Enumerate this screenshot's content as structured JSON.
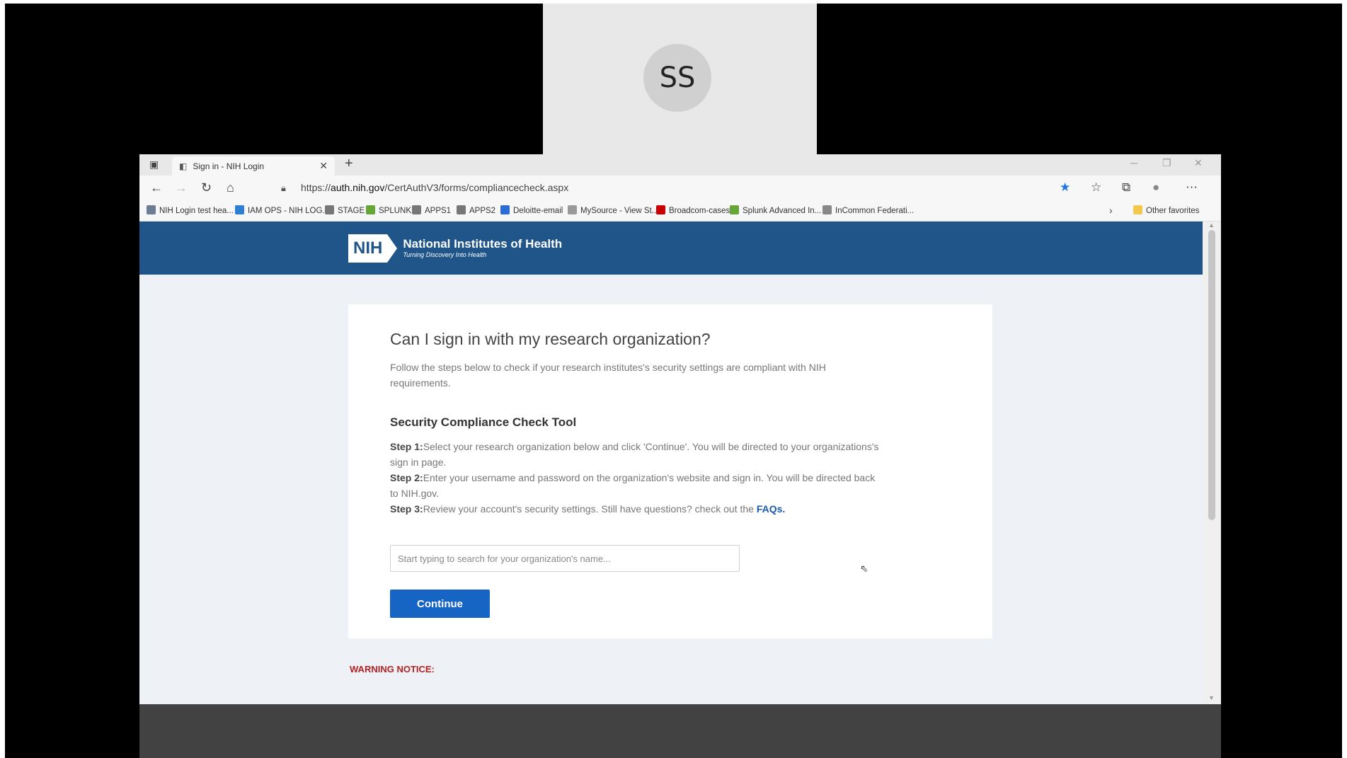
{
  "participant": {
    "initials": "SS"
  },
  "browser": {
    "tab": {
      "title": "Sign in - NIH Login"
    },
    "url": {
      "scheme": "https://",
      "host": "auth.nih.gov",
      "path": "/CertAuthV3/forms/compliancecheck.aspx"
    },
    "favorites": [
      {
        "label": "NIH Login test hea...",
        "color": "#6b7c93"
      },
      {
        "label": "IAM OPS - NIH LOG...",
        "color": "#2d7fd3"
      },
      {
        "label": "STAGE",
        "color": "#777777"
      },
      {
        "label": "SPLUNK",
        "color": "#65a637"
      },
      {
        "label": "APPS1",
        "color": "#777777"
      },
      {
        "label": "APPS2",
        "color": "#777777"
      },
      {
        "label": "Deloitte-email",
        "color": "#2b6cd6"
      },
      {
        "label": "MySource - View St...",
        "color": "#999999"
      },
      {
        "label": "Broadcom-cases",
        "color": "#cc0000"
      },
      {
        "label": "Splunk Advanced In...",
        "color": "#65a637"
      },
      {
        "label": "InCommon Federati...",
        "color": "#888888"
      }
    ],
    "other_favorites": "Other favorites"
  },
  "page": {
    "logo": {
      "mark": "NIH",
      "name": "National Institutes of Health",
      "tagline": "Turning Discovery Into Health"
    },
    "title": "Can I sign in with my research organization?",
    "intro": "Follow the steps below to check if your research institutes's security settings are compliant with NIH requirements.",
    "tool_title": "Security Compliance Check Tool",
    "steps": [
      {
        "label": "Step 1:",
        "text": "Select your research organization below and click 'Continue'. You will be directed to your organizations's sign in page."
      },
      {
        "label": "Step 2:",
        "text": "Enter your username and password on the organization's website and sign in. You will be directed back to NIH.gov."
      },
      {
        "label": "Step 3:",
        "text": "Review your account's security settings. Still have questions? check out the ",
        "link": "FAQs."
      }
    ],
    "search_placeholder": "Start typing to search for your organization's name...",
    "continue_label": "Continue",
    "warning": "WARNING NOTICE:"
  }
}
